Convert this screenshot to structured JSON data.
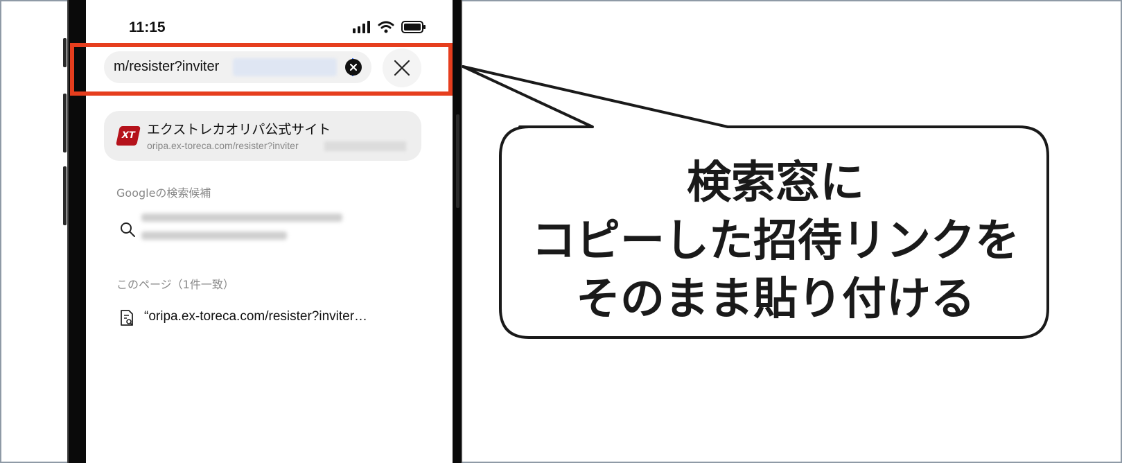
{
  "status_bar": {
    "time": "11:15"
  },
  "address_bar": {
    "url_value": "m/resister?inviter"
  },
  "top_suggestion": {
    "title": "エクストレカオリパ公式サイト",
    "url": "oripa.ex-toreca.com/resister?inviter",
    "logo_text": "XT"
  },
  "google_section": {
    "label": "Googleの検索候補"
  },
  "page_section": {
    "label": "このページ（1件一致）",
    "match_text": "“oripa.ex-toreca.com/resister?inviter…"
  },
  "callout": {
    "lines": [
      "検索窓に",
      "コピーした招待リンクを",
      "そのまま貼り付ける"
    ]
  },
  "colors": {
    "highlight": "#e63e1e",
    "accent_cursor": "#2f6bff",
    "logo_red": "#b5121b"
  },
  "icons": [
    "signal-icon",
    "wifi-icon",
    "battery-icon",
    "clear-icon",
    "close-icon",
    "search-icon",
    "page-search-icon"
  ]
}
